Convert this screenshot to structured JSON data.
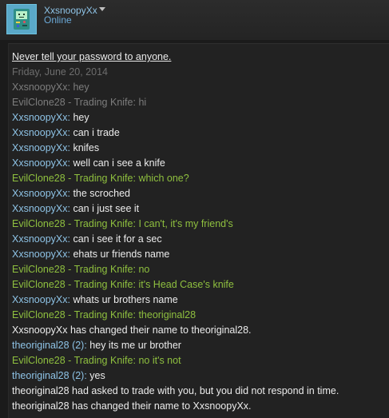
{
  "header": {
    "username": "XxsnoopyXx",
    "status": "Online"
  },
  "chat": {
    "warning": "Never tell your password to anyone.",
    "date": "Friday, June 20, 2014",
    "history": [
      {
        "name": "XxsnoopyXx",
        "sep": ": ",
        "msg": "hey"
      },
      {
        "name": "EvilClone28 - Trading Knife",
        "sep": ": ",
        "msg": "hi"
      }
    ],
    "messages": [
      {
        "name": "XxsnoopyXx",
        "sep": ": ",
        "msg": "hey",
        "color": "blue"
      },
      {
        "name": "XxsnoopyXx",
        "sep": ": ",
        "msg": "can i trade",
        "color": "blue"
      },
      {
        "name": "XxsnoopyXx",
        "sep": ": ",
        "msg": "knifes",
        "color": "blue"
      },
      {
        "name": "XxsnoopyXx",
        "sep": ": ",
        "msg": "well can i see a knife",
        "color": "blue"
      },
      {
        "name": "EvilClone28 - Trading Knife",
        "sep": ": ",
        "msg": "which one?",
        "color": "green"
      },
      {
        "name": "XxsnoopyXx",
        "sep": ": ",
        "msg": "the scroched",
        "color": "blue"
      },
      {
        "name": "XxsnoopyXx",
        "sep": ": ",
        "msg": "can i just see it",
        "color": "blue"
      },
      {
        "name": "EvilClone28 - Trading Knife",
        "sep": ": ",
        "msg": "I can't, it's my friend's",
        "color": "green"
      },
      {
        "name": "XxsnoopyXx",
        "sep": ": ",
        "msg": "can i see it for a sec",
        "color": "blue"
      },
      {
        "name": "XxsnoopyXx",
        "sep": ": ",
        "msg": "ehats ur friends name",
        "color": "blue"
      },
      {
        "name": "EvilClone28 - Trading Knife",
        "sep": ": ",
        "msg": "no",
        "color": "green"
      },
      {
        "name": "EvilClone28 - Trading Knife",
        "sep": ": ",
        "msg": "it's Head Case's knife",
        "color": "green"
      },
      {
        "name": "XxsnoopyXx",
        "sep": ": ",
        "msg": "whats ur brothers name",
        "color": "blue"
      },
      {
        "name": "EvilClone28 - Trading Knife",
        "sep": ": ",
        "msg": "theoriginal28",
        "color": "green"
      },
      {
        "system": "XxsnoopyXx has changed their name to theoriginal28."
      },
      {
        "name": "theoriginal28",
        "sep": " (2): ",
        "msg": "hey its me ur brother",
        "color": "blue"
      },
      {
        "name": "EvilClone28 - Trading Knife",
        "sep": ": ",
        "msg": "no it's not",
        "color": "green"
      },
      {
        "name": "theoriginal28",
        "sep": " (2): ",
        "msg": "yes",
        "color": "blue"
      },
      {
        "system": "theoriginal28 had asked to trade with you, but you did not respond in time."
      },
      {
        "system": "theoriginal28 has changed their name to XxsnoopyXx."
      }
    ]
  }
}
